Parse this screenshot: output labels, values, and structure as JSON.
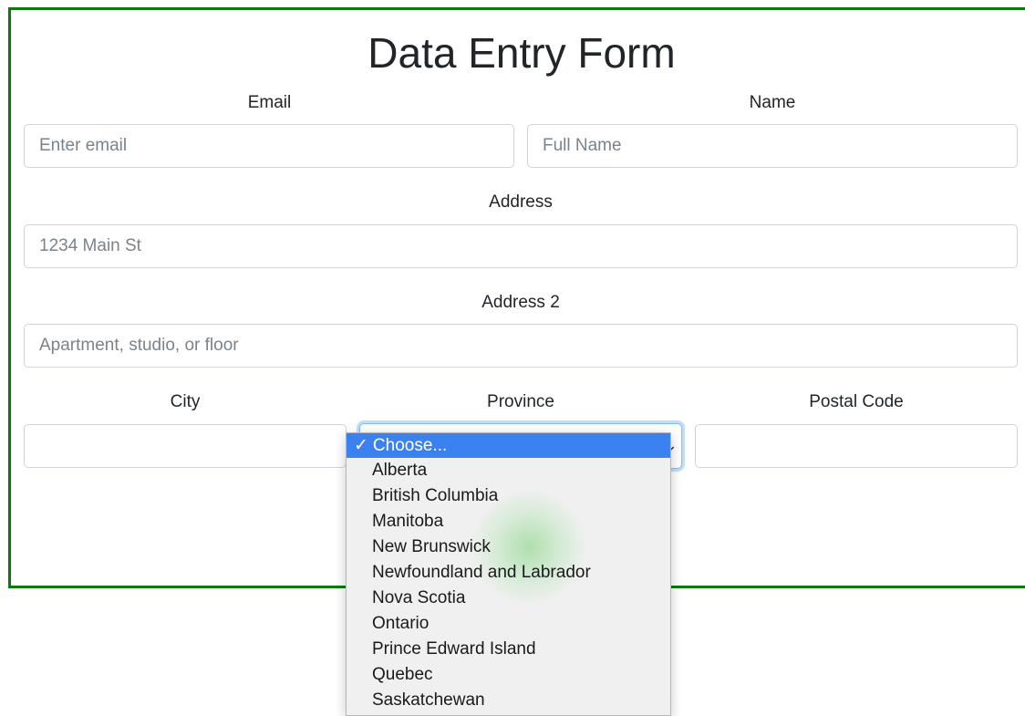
{
  "form": {
    "title": "Data Entry Form",
    "email": {
      "label": "Email",
      "placeholder": "Enter email",
      "value": ""
    },
    "name": {
      "label": "Name",
      "placeholder": "Full Name",
      "value": ""
    },
    "address": {
      "label": "Address",
      "placeholder": "1234 Main St",
      "value": ""
    },
    "address2": {
      "label": "Address 2",
      "placeholder": "Apartment, studio, or floor",
      "value": ""
    },
    "city": {
      "label": "City",
      "value": ""
    },
    "province": {
      "label": "Province",
      "selected": "Choose...",
      "check_mark": "✓",
      "options": [
        "Choose...",
        "Alberta",
        "British Columbia",
        "Manitoba",
        "New Brunswick",
        "Newfoundland and Labrador",
        "Nova Scotia",
        "Ontario",
        "Prince Edward Island",
        "Quebec",
        "Saskatchewan"
      ]
    },
    "postal_code": {
      "label": "Postal Code",
      "value": ""
    }
  },
  "colors": {
    "frame_border": "#0a7a0a",
    "focus_border": "#80bdff",
    "selected_option": "#3b82f0"
  },
  "icons": {
    "select_caret": "chevron-down-icon",
    "selected_mark": "checkmark-icon"
  }
}
